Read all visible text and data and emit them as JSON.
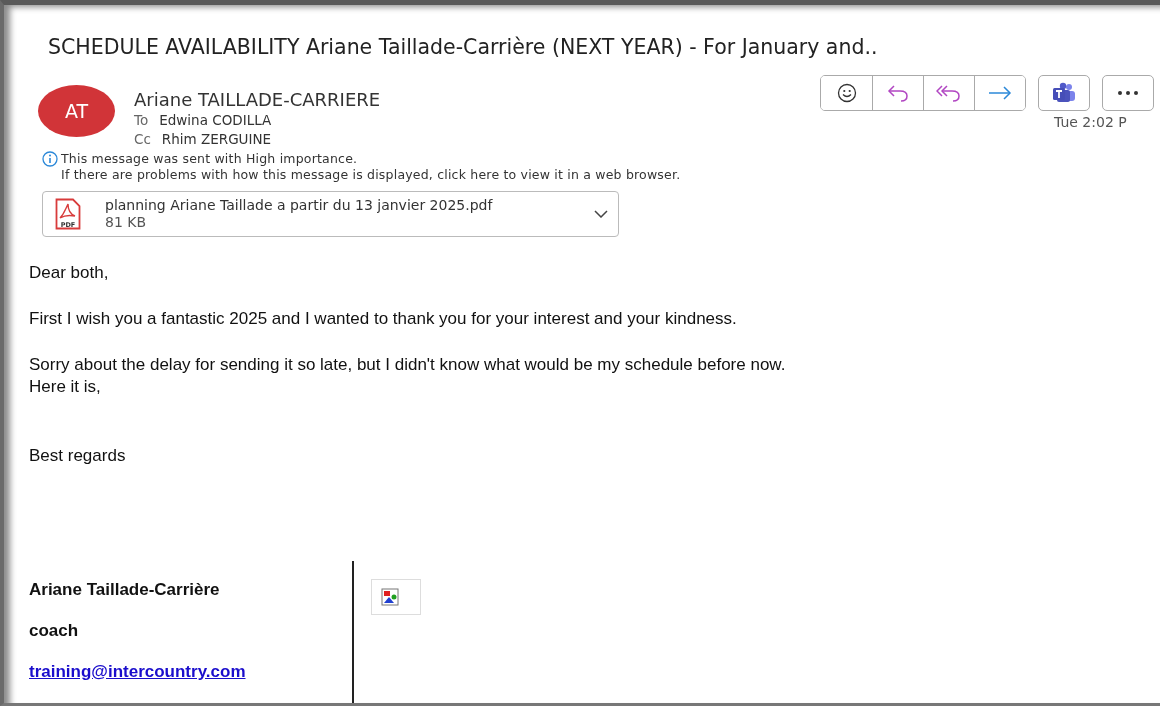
{
  "subject": "SCHEDULE AVAILABILITY Ariane Taillade-Carrière (NEXT YEAR) - For January and..",
  "sender": {
    "initials": "AT",
    "name": "Ariane TAILLADE-CARRIERE",
    "color": "#d13438"
  },
  "recipients": [
    {
      "label": "To",
      "name": "Edwina CODILLA"
    },
    {
      "label": "Cc",
      "name": "Rhim ZERGUINE"
    }
  ],
  "time": "Tue 2:02 P",
  "notices": [
    "This message was sent with High importance.",
    "If there are problems with how this message is displayed, click here to view it in a web browser."
  ],
  "attachment": {
    "name": "planning Ariane Taillade a partir du 13 janvier 2025.pdf",
    "size": "81 KB",
    "badge": "PDF"
  },
  "body": [
    [
      "Dear both,"
    ],
    [
      "First I wish you a fantastic 2025 and I wanted to thank you for your interest and your kindness."
    ],
    [
      "Sorry about the delay for sending it so late, but I didn't know what would be my schedule before now.",
      "Here it is,"
    ]
  ],
  "closing": "Best regards",
  "signature": {
    "name": "Ariane Taillade-Carrière",
    "title": "coach",
    "email": "training@intercountry.com"
  }
}
